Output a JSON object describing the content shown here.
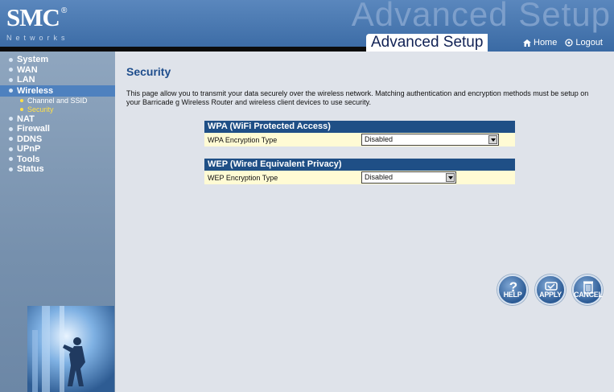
{
  "header": {
    "brand": "SMC",
    "brand_mark": "®",
    "brand_sub": "Networks",
    "watermark": "Advanced Setup",
    "title": "Advanced Setup",
    "links": [
      {
        "label": "Home",
        "icon": "home-icon"
      },
      {
        "label": "Logout",
        "icon": "logout-icon"
      }
    ]
  },
  "sidebar": {
    "items": [
      {
        "label": "System"
      },
      {
        "label": "WAN"
      },
      {
        "label": "LAN"
      },
      {
        "label": "Wireless",
        "active": true
      },
      {
        "label": "NAT"
      },
      {
        "label": "Firewall"
      },
      {
        "label": "DDNS"
      },
      {
        "label": "UPnP"
      },
      {
        "label": "Tools"
      },
      {
        "label": "Status"
      }
    ],
    "subitems": [
      {
        "label": "Channel and SSID"
      },
      {
        "label": "Security",
        "current": true
      }
    ]
  },
  "main": {
    "title": "Security",
    "intro": "This page allow you to transmit your data securely over the wireless network. Matching authentication and encryption methods must be setup on your Barricade g Wireless Router and wireless client devices to use security.",
    "wpa": {
      "header": "WPA (WiFi Protected Access)",
      "label": "WPA Encryption Type",
      "value": "Disabled"
    },
    "wep": {
      "header": "WEP (Wired Equivalent Privacy)",
      "label": "WEP Encryption Type",
      "value": "Disabled"
    },
    "buttons": {
      "help": "HELP",
      "apply": "APPLY",
      "cancel": "CANCEL"
    }
  },
  "colors": {
    "header_bg": "#3a6aa4",
    "section_header": "#1f4f86",
    "row_bg": "#fffbd4",
    "active_menu": "#4e81bf",
    "current_sub": "#ffe046",
    "title_text": "#1e4d8c"
  }
}
